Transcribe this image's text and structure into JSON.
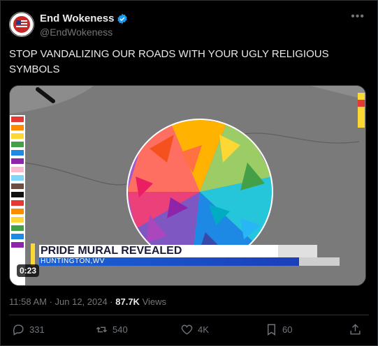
{
  "author": {
    "name": "End Wokeness",
    "handle": "@EndWokeness",
    "verified": true
  },
  "post": {
    "text": "STOP VANDALIZING OUR ROADS WITH YOUR UGLY RELIGIOUS SYMBOLS",
    "time": "11:58 AM · Jun 12, 2024 · ",
    "views_count": "87.7K",
    "views_label": " Views"
  },
  "media": {
    "headline": "PRIDE MURAL REVEALED",
    "location": "HUNTINGTON,WV",
    "duration": "0:23"
  },
  "actions": {
    "replies": "331",
    "reposts": "540",
    "likes": "4K",
    "bookmarks": "60"
  },
  "colors": {
    "verified": "#1d9bf0",
    "muted": "#71767b",
    "banner_blue": "#1a62d6"
  }
}
